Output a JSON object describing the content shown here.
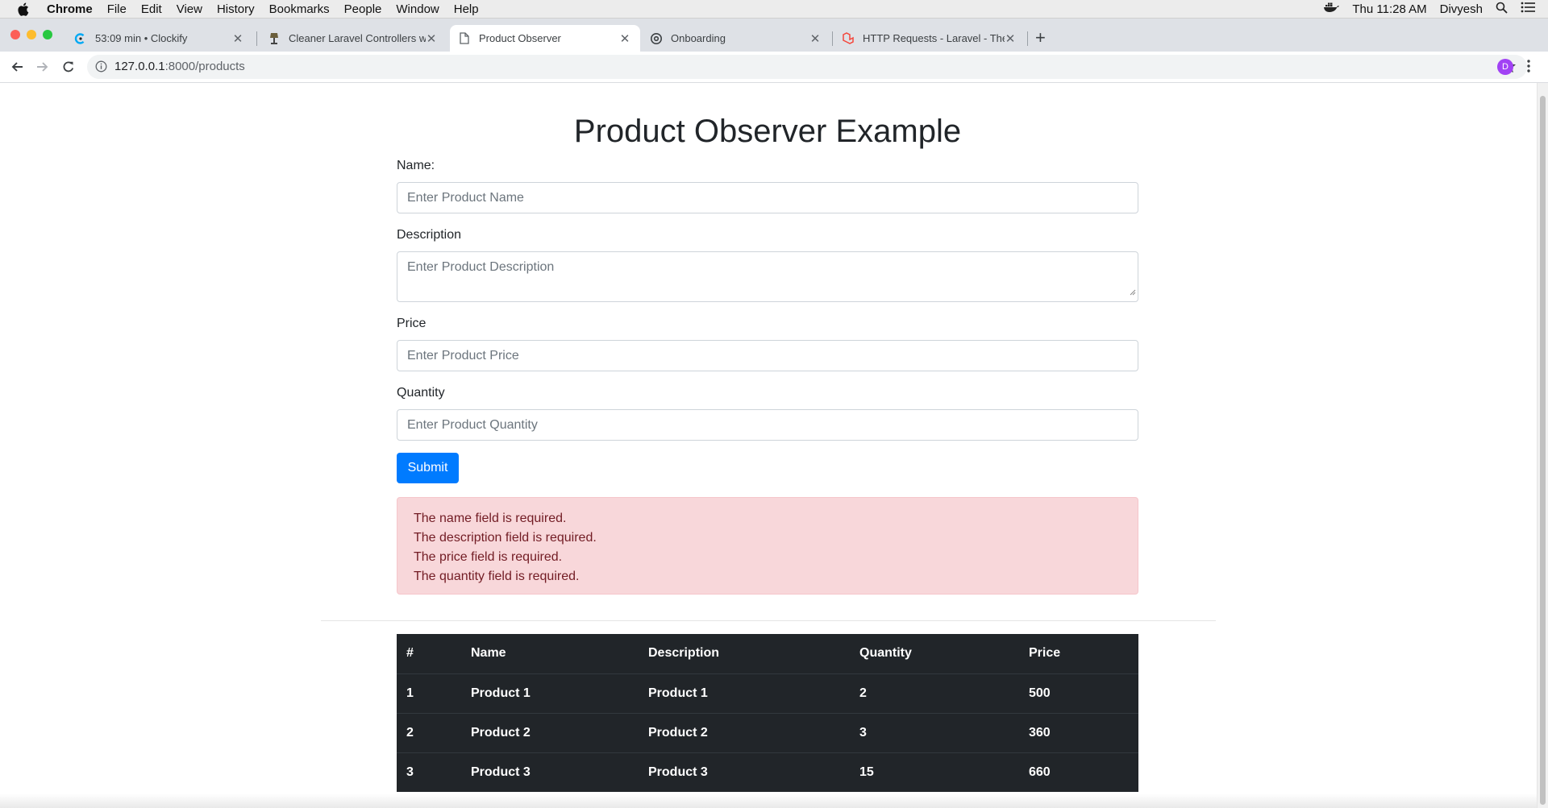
{
  "menubar": {
    "items": [
      "Chrome",
      "File",
      "Edit",
      "View",
      "History",
      "Bookmarks",
      "People",
      "Window",
      "Help"
    ],
    "clock": "Thu 11:28 AM",
    "user": "Divyesh"
  },
  "tabs": [
    {
      "title": "53:09 min • Clockify",
      "icon": "clockify-icon"
    },
    {
      "title": "Cleaner Laravel Controllers wit",
      "icon": "lamp-icon"
    },
    {
      "title": "Product Observer",
      "icon": "page-icon"
    },
    {
      "title": "Onboarding",
      "icon": "gear-icon"
    },
    {
      "title": "HTTP Requests - Laravel - The",
      "icon": "laravel-icon"
    }
  ],
  "address": {
    "host": "127.0.0.1",
    "path": ":8000/products"
  },
  "profile_initial": "D",
  "page": {
    "title": "Product Observer Example",
    "form": {
      "name_label": "Name:",
      "name_placeholder": "Enter Product Name",
      "description_label": "Description",
      "description_placeholder": "Enter Product Description",
      "price_label": "Price",
      "price_placeholder": "Enter Product Price",
      "quantity_label": "Quantity",
      "quantity_placeholder": "Enter Product Quantity",
      "submit_label": "Submit"
    },
    "errors": [
      "The name field is required.",
      "The description field is required.",
      "The price field is required.",
      "The quantity field is required."
    ],
    "table": {
      "headers": [
        "#",
        "Name",
        "Description",
        "Quantity",
        "Price"
      ],
      "rows": [
        [
          "1",
          "Product 1",
          "Product 1",
          "2",
          "500"
        ],
        [
          "2",
          "Product 2",
          "Product 2",
          "3",
          "360"
        ],
        [
          "3",
          "Product 3",
          "Product 3",
          "15",
          "660"
        ]
      ]
    }
  },
  "colors": {
    "primary": "#007bff",
    "alert_bg": "#f8d7da",
    "alert_text": "#721c24",
    "table_dark": "#212529"
  }
}
